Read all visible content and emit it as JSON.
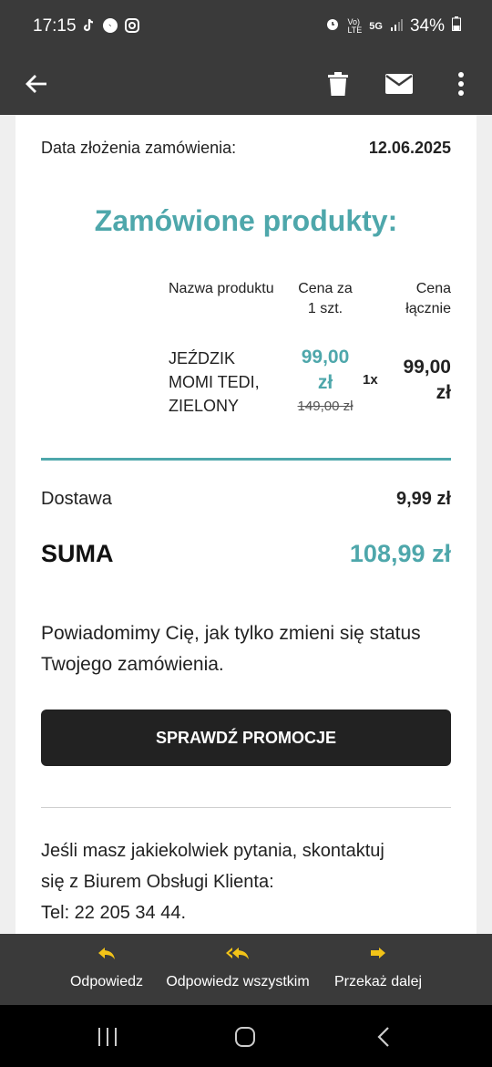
{
  "status_bar": {
    "time": "17:15",
    "battery": "34%",
    "network": "5G"
  },
  "app_bar": {
    "back": "back-arrow",
    "delete": "trash-icon",
    "mark": "envelope-icon",
    "more": "more-icon"
  },
  "email": {
    "order_date_label": "Data złożenia zamówienia:",
    "order_date_value": "12.06.2025",
    "products_heading": "Zamówione produkty:",
    "table_headers": {
      "name": "Nazwa produktu",
      "unit_price_1": "Cena za",
      "unit_price_2": "1 szt.",
      "total_1": "Cena",
      "total_2": "łącznie"
    },
    "product": {
      "name_1": "JEŹDZIK",
      "name_2": "MOMI TEDI,",
      "name_3": "ZIELONY",
      "unit_price_1": "99,00",
      "unit_price_2": "zł",
      "old_price": "149,00 zł",
      "qty": "1x",
      "total_1": "99,00",
      "total_2": "zł"
    },
    "delivery_label": "Dostawa",
    "delivery_value": "9,99 zł",
    "sum_label": "SUMA",
    "sum_value": "108,99 zł",
    "notice": "Powiadomimy Cię, jak tylko zmieni się status Twojego zamówienia.",
    "cta": "SPRAWDŹ PROMOCJE",
    "contact_1": "Jeśli masz jakiekolwiek pytania, skontaktuj",
    "contact_2": "się z Biurem Obsługi Klienta:",
    "contact_3": "Tel: 22 205 34 44."
  },
  "actions": {
    "reply": "Odpowiedz",
    "reply_all": "Odpowiedz wszystkim",
    "forward": "Przekaż dalej"
  },
  "colors": {
    "accent": "#4ea7ab",
    "bar": "#3a3a3a",
    "action_icon": "#f2c318"
  }
}
